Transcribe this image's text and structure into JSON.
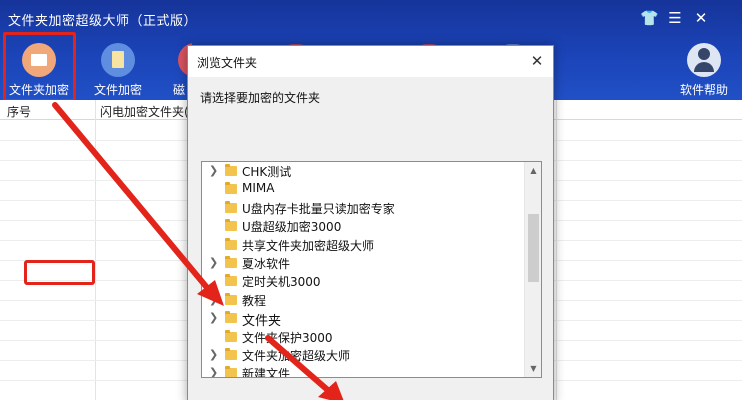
{
  "app": {
    "title": "文件夹加密超级大师（正式版）",
    "window_controls": {
      "skin": "👕",
      "menu": "☰",
      "close": "✕"
    }
  },
  "toolbar": {
    "folder_encrypt": "文件夹加密",
    "file_encrypt": "文件加密",
    "disk_partial": "磁",
    "help": "软件帮助"
  },
  "table": {
    "columns": [
      "序号",
      "闪电加密文件夹("
    ]
  },
  "dialog": {
    "title": "浏览文件夹",
    "close": "✕",
    "prompt": "请选择要加密的文件夹",
    "tree": [
      {
        "name": "CHK测试",
        "expandable": true
      },
      {
        "name": "MIMA",
        "expandable": false
      },
      {
        "name": "U盘内存卡批量只读加密专家",
        "expandable": false
      },
      {
        "name": "U盘超级加密3000",
        "expandable": false
      },
      {
        "name": "共享文件夹加密超级大师",
        "expandable": false
      },
      {
        "name": "夏冰软件",
        "expandable": true
      },
      {
        "name": "定时关机3000",
        "expandable": false
      },
      {
        "name": "教程",
        "expandable": true
      },
      {
        "name": "文件夹",
        "expandable": true
      },
      {
        "name": "文件夹保护3000",
        "expandable": false
      },
      {
        "name": "文件夹加密超级大师",
        "expandable": true
      },
      {
        "name": "新建文件",
        "expandable": true
      }
    ],
    "scroll_up": "▲",
    "scroll_down": "▼"
  },
  "colors": {
    "header_blue": "#1b44b8",
    "highlight_red": "#e2241b",
    "folder_yellow": "#f2c34d"
  }
}
